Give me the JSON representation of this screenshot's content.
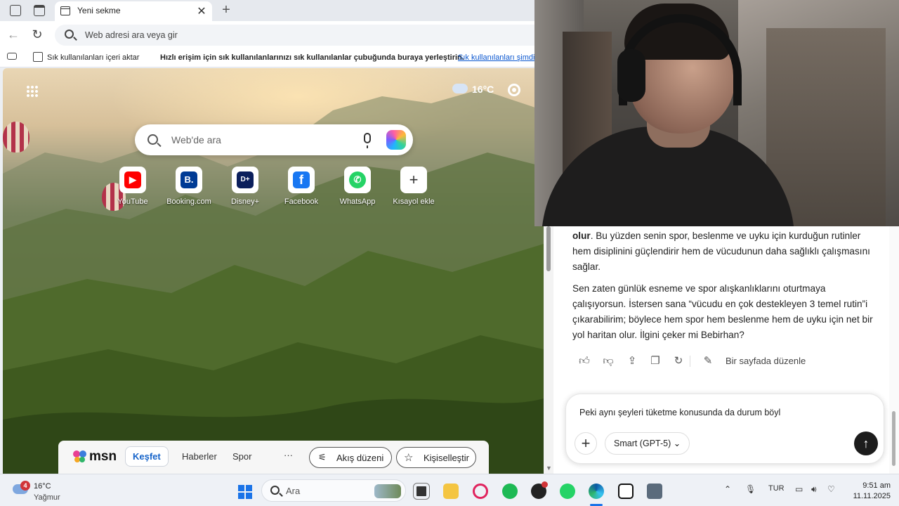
{
  "browser": {
    "tab_title": "Yeni sekme",
    "address_placeholder": "Web adresi ara veya gir",
    "favorites_bar": {
      "import_label": "Sık kullanılanları içeri aktar",
      "hint": "Hızlı erişim için sık kullanılanlarınızı sık kullanılanlar çubuğunda buraya yerleştirin.",
      "link": "Sık kullanılanları şimdi yönetin"
    }
  },
  "ntp": {
    "weather_temp": "16°C",
    "search_placeholder": "Web'de ara",
    "quick_links": [
      {
        "label": "YouTube",
        "glyph": "▶",
        "color": "#ff0000"
      },
      {
        "label": "Booking.com",
        "glyph": "B.",
        "color": "#003b95"
      },
      {
        "label": "Disney+",
        "glyph": "D+",
        "color": "#0b1f5c"
      },
      {
        "label": "Facebook",
        "glyph": "f",
        "color": "#1877f2"
      },
      {
        "label": "WhatsApp",
        "glyph": "✆",
        "color": "#25d366"
      },
      {
        "label": "Kısayol ekle",
        "glyph": "+",
        "color": "#ffffff"
      }
    ],
    "msn": {
      "logo": "msn",
      "tabs": [
        "Keşfet",
        "Haberler",
        "Spor"
      ],
      "more": "···",
      "feed_layout": "Akış düzeni",
      "personalize": "Kişiselleştir"
    }
  },
  "chat": {
    "para1_bold": "olur",
    "para1_rest": ". Bu yüzden senin spor, beslenme ve uyku için kurduğun rutinler hem disiplinini güçlendirir hem de vücudunun daha sağlıklı çalışmasını sağlar.",
    "para2": "Sen zaten günlük esneme ve spor alışkanlıklarını oturtmaya çalışıyorsun. İstersen sana “vücudu en çok destekleyen 3 temel rutin”i çıkarabilirim; böylece hem spor hem beslenme hem de uyku için net bir yol haritan olur. İlgini çeker mi Bebirhan?",
    "edit_on_page": "Bir sayfada düzenle",
    "composer_text": "Peki aynı şeyleri tüketme konusunda da durum böyl",
    "model": "Smart (GPT-5)"
  },
  "taskbar": {
    "weather_badge": "4",
    "weather_temp": "16°C",
    "weather_desc": "Yağmur",
    "search_placeholder": "Ara",
    "language": "TUR",
    "time": "9:51 am",
    "date": "11.11.2025"
  }
}
